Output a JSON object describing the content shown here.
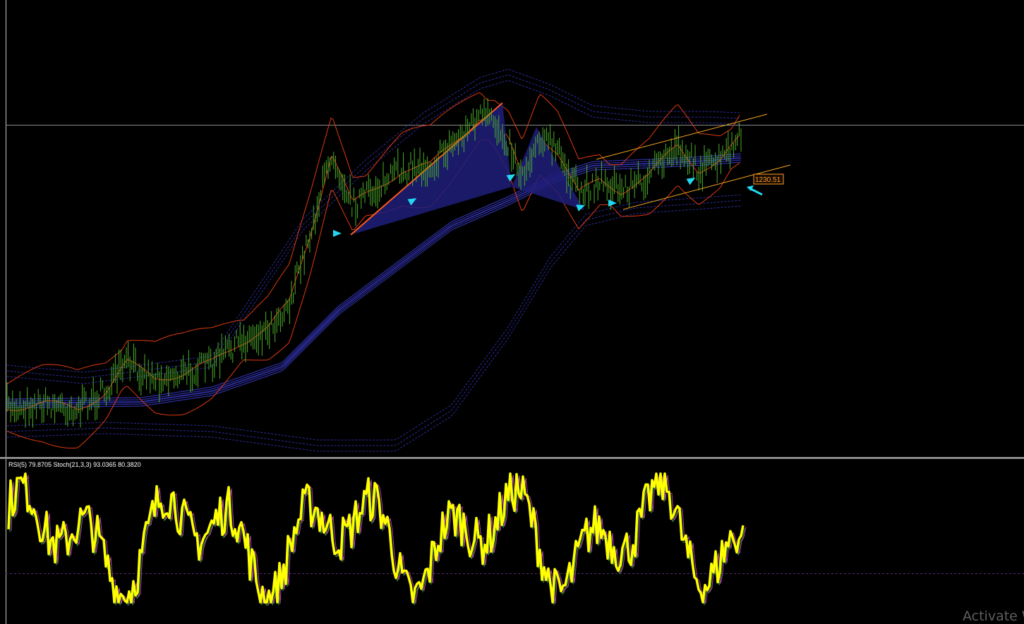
{
  "main_chart": {
    "price_label": "1230.51",
    "colors": {
      "background": "#000000",
      "bar": "#4caf2a",
      "bollinger": "#e03a10",
      "envelope": "#2c2c9a",
      "pattern_fill": "#1f1f7a",
      "pattern_edge": "#ff5a1a",
      "channel": "#f5a623",
      "arrow": "#22d8f0",
      "hline": "#8a8a8a"
    }
  },
  "indicator_panel": {
    "label": "RSI(5) 79.8705  Stoch(21,3,3) 93.0365 80.3820",
    "colors": {
      "rsi": "#ffff00",
      "stoch_main": "#2e9a2e",
      "stoch_signal": "#b040b0",
      "level": "#5a2a7a"
    }
  },
  "watermark": {
    "text": "Activate W"
  }
}
